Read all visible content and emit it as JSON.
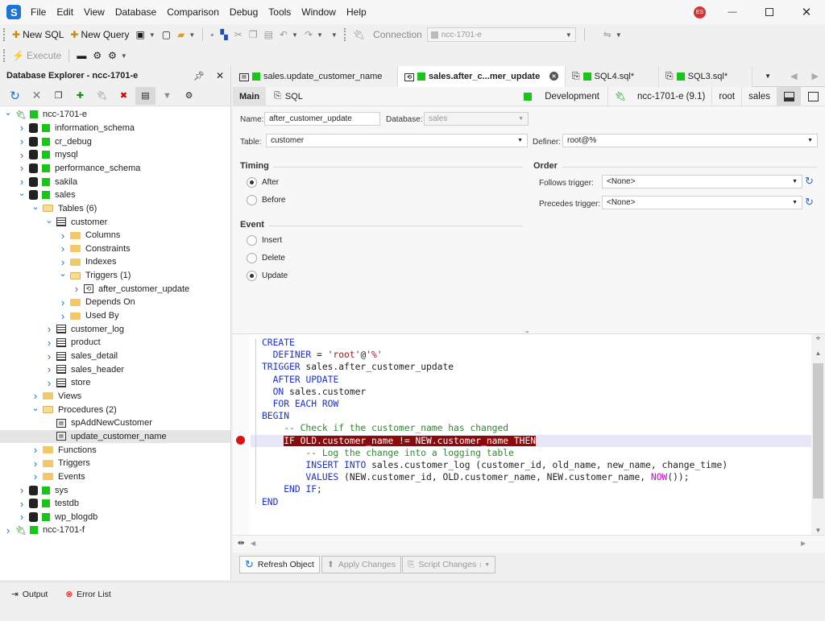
{
  "app": {
    "menu": [
      "File",
      "Edit",
      "View",
      "Database",
      "Comparison",
      "Debug",
      "Tools",
      "Window",
      "Help"
    ],
    "user_initials": "ES"
  },
  "toolbar": {
    "new_sql": "New SQL",
    "new_query": "New Query",
    "connection_label": "Connection",
    "connection_value": "ncc-1701-e",
    "execute": "Execute"
  },
  "explorer": {
    "title": "Database Explorer - ncc-1701-e",
    "tree": [
      {
        "label": "ncc-1701-e",
        "type": "conn",
        "depth": 0,
        "arrow": "open"
      },
      {
        "label": "information_schema",
        "type": "db",
        "depth": 1,
        "arrow": "closed"
      },
      {
        "label": "cr_debug",
        "type": "db",
        "depth": 1,
        "arrow": "closed"
      },
      {
        "label": "mysql",
        "type": "db",
        "depth": 1,
        "arrow": "closed"
      },
      {
        "label": "performance_schema",
        "type": "db",
        "depth": 1,
        "arrow": "closed"
      },
      {
        "label": "sakila",
        "type": "db",
        "depth": 1,
        "arrow": "closed"
      },
      {
        "label": "sales",
        "type": "db",
        "depth": 1,
        "arrow": "open"
      },
      {
        "label": "Tables (6)",
        "type": "folder-open",
        "depth": 2,
        "arrow": "open"
      },
      {
        "label": "customer",
        "type": "table",
        "depth": 3,
        "arrow": "open"
      },
      {
        "label": "Columns",
        "type": "folder",
        "depth": 4,
        "arrow": "closed"
      },
      {
        "label": "Constraints",
        "type": "folder",
        "depth": 4,
        "arrow": "closed"
      },
      {
        "label": "Indexes",
        "type": "folder",
        "depth": 4,
        "arrow": "closed"
      },
      {
        "label": "Triggers (1)",
        "type": "folder-open",
        "depth": 4,
        "arrow": "open"
      },
      {
        "label": "after_customer_update",
        "type": "trigger",
        "depth": 5,
        "arrow": "closed"
      },
      {
        "label": "Depends On",
        "type": "folder",
        "depth": 4,
        "arrow": "closed"
      },
      {
        "label": "Used By",
        "type": "folder",
        "depth": 4,
        "arrow": "closed"
      },
      {
        "label": "customer_log",
        "type": "table",
        "depth": 3,
        "arrow": "closed"
      },
      {
        "label": "product",
        "type": "table",
        "depth": 3,
        "arrow": "closed"
      },
      {
        "label": "sales_detail",
        "type": "table",
        "depth": 3,
        "arrow": "closed"
      },
      {
        "label": "sales_header",
        "type": "table",
        "depth": 3,
        "arrow": "closed"
      },
      {
        "label": "store",
        "type": "table",
        "depth": 3,
        "arrow": "closed"
      },
      {
        "label": "Views",
        "type": "folder",
        "depth": 2,
        "arrow": "closed"
      },
      {
        "label": "Procedures (2)",
        "type": "folder-open",
        "depth": 2,
        "arrow": "open"
      },
      {
        "label": "spAddNewCustomer",
        "type": "proc",
        "depth": 3,
        "arrow": "none"
      },
      {
        "label": "update_customer_name",
        "type": "proc",
        "depth": 3,
        "arrow": "none",
        "selected": true
      },
      {
        "label": "Functions",
        "type": "folder",
        "depth": 2,
        "arrow": "closed"
      },
      {
        "label": "Triggers",
        "type": "folder",
        "depth": 2,
        "arrow": "closed"
      },
      {
        "label": "Events",
        "type": "folder",
        "depth": 2,
        "arrow": "closed"
      },
      {
        "label": "sys",
        "type": "db",
        "depth": 1,
        "arrow": "closed"
      },
      {
        "label": "testdb",
        "type": "db",
        "depth": 1,
        "arrow": "closed"
      },
      {
        "label": "wp_blogdb",
        "type": "db",
        "depth": 1,
        "arrow": "closed"
      },
      {
        "label": "ncc-1701-f",
        "type": "conn",
        "depth": 0,
        "arrow": "closed"
      }
    ]
  },
  "tabs": [
    {
      "label": "sales.update_customer_name",
      "active": false,
      "icon": "procedure-icon"
    },
    {
      "label": "sales.after_c...mer_update",
      "active": true,
      "icon": "trigger-icon"
    },
    {
      "label": "SQL4.sql*",
      "active": false,
      "icon": "sql-file-icon"
    },
    {
      "label": "SQL3.sql*",
      "active": false,
      "icon": "sql-file-icon"
    }
  ],
  "subhead": {
    "main": "Main",
    "sql": "SQL",
    "environment": "Development",
    "conn": "ncc-1701-e (9.1)",
    "user": "root",
    "db": "sales"
  },
  "props": {
    "name_label": "Name:",
    "name_value": "after_customer_update",
    "database_label": "Database:",
    "database_value": "sales",
    "table_label": "Table:",
    "table_value": "customer",
    "definer_label": "Definer:",
    "definer_value": "root@%",
    "timing_title": "Timing",
    "timing_after": "After",
    "timing_before": "Before",
    "order_title": "Order",
    "follows_label": "Follows trigger:",
    "follows_value": "<None>",
    "precedes_label": "Precedes trigger:",
    "precedes_value": "<None>",
    "event_title": "Event",
    "event_insert": "Insert",
    "event_delete": "Delete",
    "event_update": "Update",
    "timing_selected": "After",
    "event_selected": "Update"
  },
  "code": [
    "CREATE",
    "  DEFINER = 'root'@'%'",
    "TRIGGER sales.after_customer_update",
    "  AFTER UPDATE",
    "  ON sales.customer",
    "  FOR EACH ROW",
    "BEGIN",
    "    -- Check if the customer_name has changed",
    "    IF OLD.customer_name != NEW.customer_name THEN",
    "        -- Log the change into a logging table",
    "        INSERT INTO sales.customer_log (customer_id, old_name, new_name, change_time)",
    "        VALUES (NEW.customer_id, OLD.customer_name, NEW.customer_name, NOW());",
    "    END IF;",
    "END"
  ],
  "buttons": {
    "refresh": "Refresh Object",
    "apply": "Apply Changes",
    "script": "Script Changes"
  },
  "status": {
    "output": "Output",
    "errors": "Error List"
  }
}
